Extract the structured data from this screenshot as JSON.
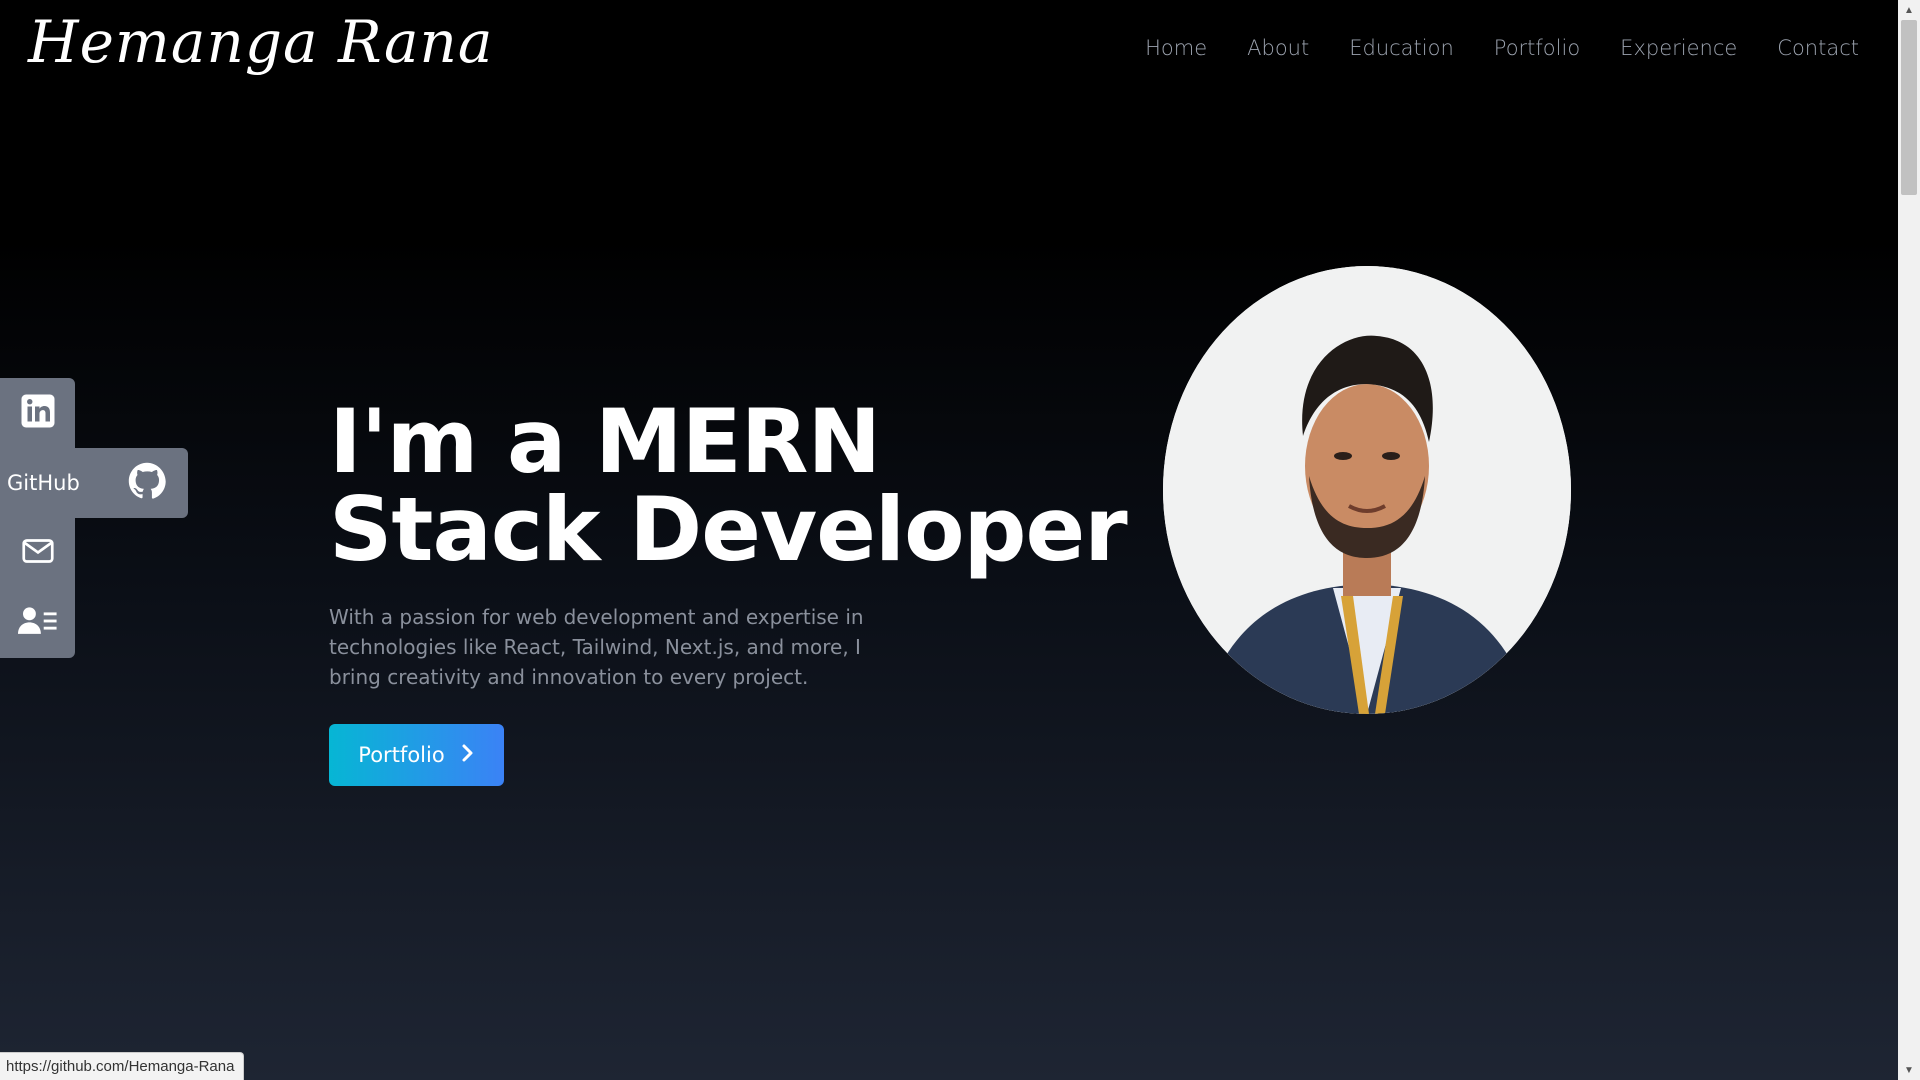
{
  "header": {
    "logo_text": "Hemanga Rana",
    "nav": [
      {
        "label": "Home"
      },
      {
        "label": "About"
      },
      {
        "label": "Education"
      },
      {
        "label": "Portfolio"
      },
      {
        "label": "Experience"
      },
      {
        "label": "Contact"
      }
    ]
  },
  "social_bar": {
    "items": [
      {
        "icon": "linkedin-icon"
      },
      {
        "icon": "github-icon",
        "label": "GitHub"
      },
      {
        "icon": "mail-icon"
      },
      {
        "icon": "resume-icon"
      }
    ]
  },
  "hero": {
    "title": "I'm a MERN Stack Developer",
    "description": "With a passion for web development and expertise in technologies like React, Tailwind, Next.js, and more, I bring creativity and innovation to every project.",
    "cta_label": "Portfolio",
    "cta_icon": "chevron-right-icon"
  },
  "status_bar": {
    "url": "https://github.com/Hemanga-Rana"
  },
  "colors": {
    "accent_start": "#06b6d4",
    "accent_end": "#3b82f6",
    "social_bg": "#6b7280",
    "nav_text": "#9ca3af"
  }
}
